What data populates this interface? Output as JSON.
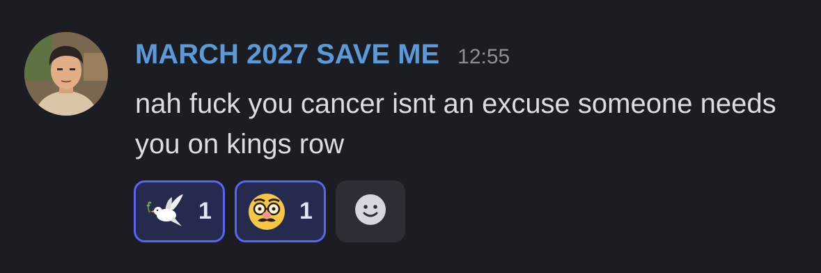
{
  "message": {
    "author": "MARCH 2027 SAVE ME",
    "timestamp": "12:55",
    "content": "nah fuck you cancer isnt an excuse someone needs you on kings row"
  },
  "reactions": [
    {
      "icon": "dove-icon",
      "count": "1"
    },
    {
      "icon": "disguised-face-icon",
      "count": "1"
    }
  ],
  "add_reaction_icon": "smiley-face-icon",
  "colors": {
    "background": "#1c1d22",
    "username": "#5a9ad8",
    "reaction_border": "#5c64f4",
    "reaction_bg": "#262a4f"
  }
}
